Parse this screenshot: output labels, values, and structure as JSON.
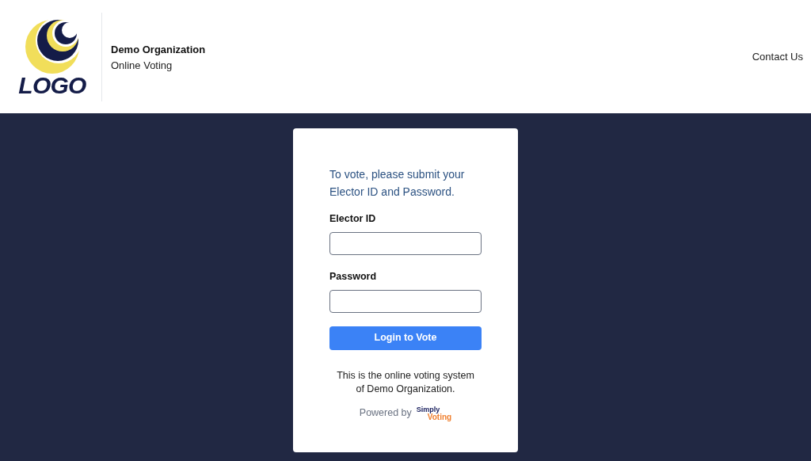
{
  "header": {
    "logo_text": "LOGO",
    "organization": "Demo Organization",
    "subtitle": "Online Voting",
    "nav": [
      "Contact Us"
    ]
  },
  "login": {
    "intro": "To vote, please submit your Elector ID and Password.",
    "fields": [
      {
        "label": "Elector ID"
      },
      {
        "label": "Password"
      }
    ],
    "submit": "Login to Vote",
    "note": "This is the online voting system of Demo Organization.",
    "powered_by": "Powered by",
    "brand": [
      "Simply",
      "Voting"
    ]
  }
}
